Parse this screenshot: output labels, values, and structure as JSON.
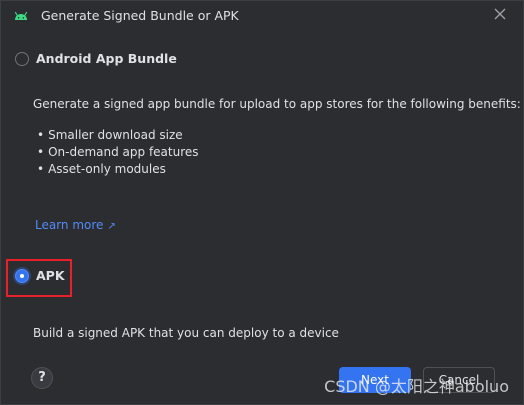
{
  "window": {
    "title": "Generate Signed Bundle or APK",
    "icons": {
      "app": "android-icon",
      "close": "close-icon"
    }
  },
  "options": {
    "bundle": {
      "label": "Android App Bundle",
      "selected": false,
      "description": "Generate a signed app bundle for upload to app stores for the following benefits:",
      "benefits": [
        "Smaller download size",
        "On-demand app features",
        "Asset-only modules"
      ],
      "learn_more": "Learn more",
      "learn_more_icon": "external-link-icon"
    },
    "apk": {
      "label": "APK",
      "selected": true,
      "description": "Build a signed APK that you can deploy to a device"
    }
  },
  "footer": {
    "help": "?",
    "next": "Next",
    "cancel": "Cancel"
  },
  "watermark": "CSDN @太阳之神aboluo",
  "colors": {
    "background": "#2b2d30",
    "text": "#dfe1e5",
    "link": "#548af7",
    "primary_button": "#3574f0",
    "highlight_box": "#e8202a"
  }
}
